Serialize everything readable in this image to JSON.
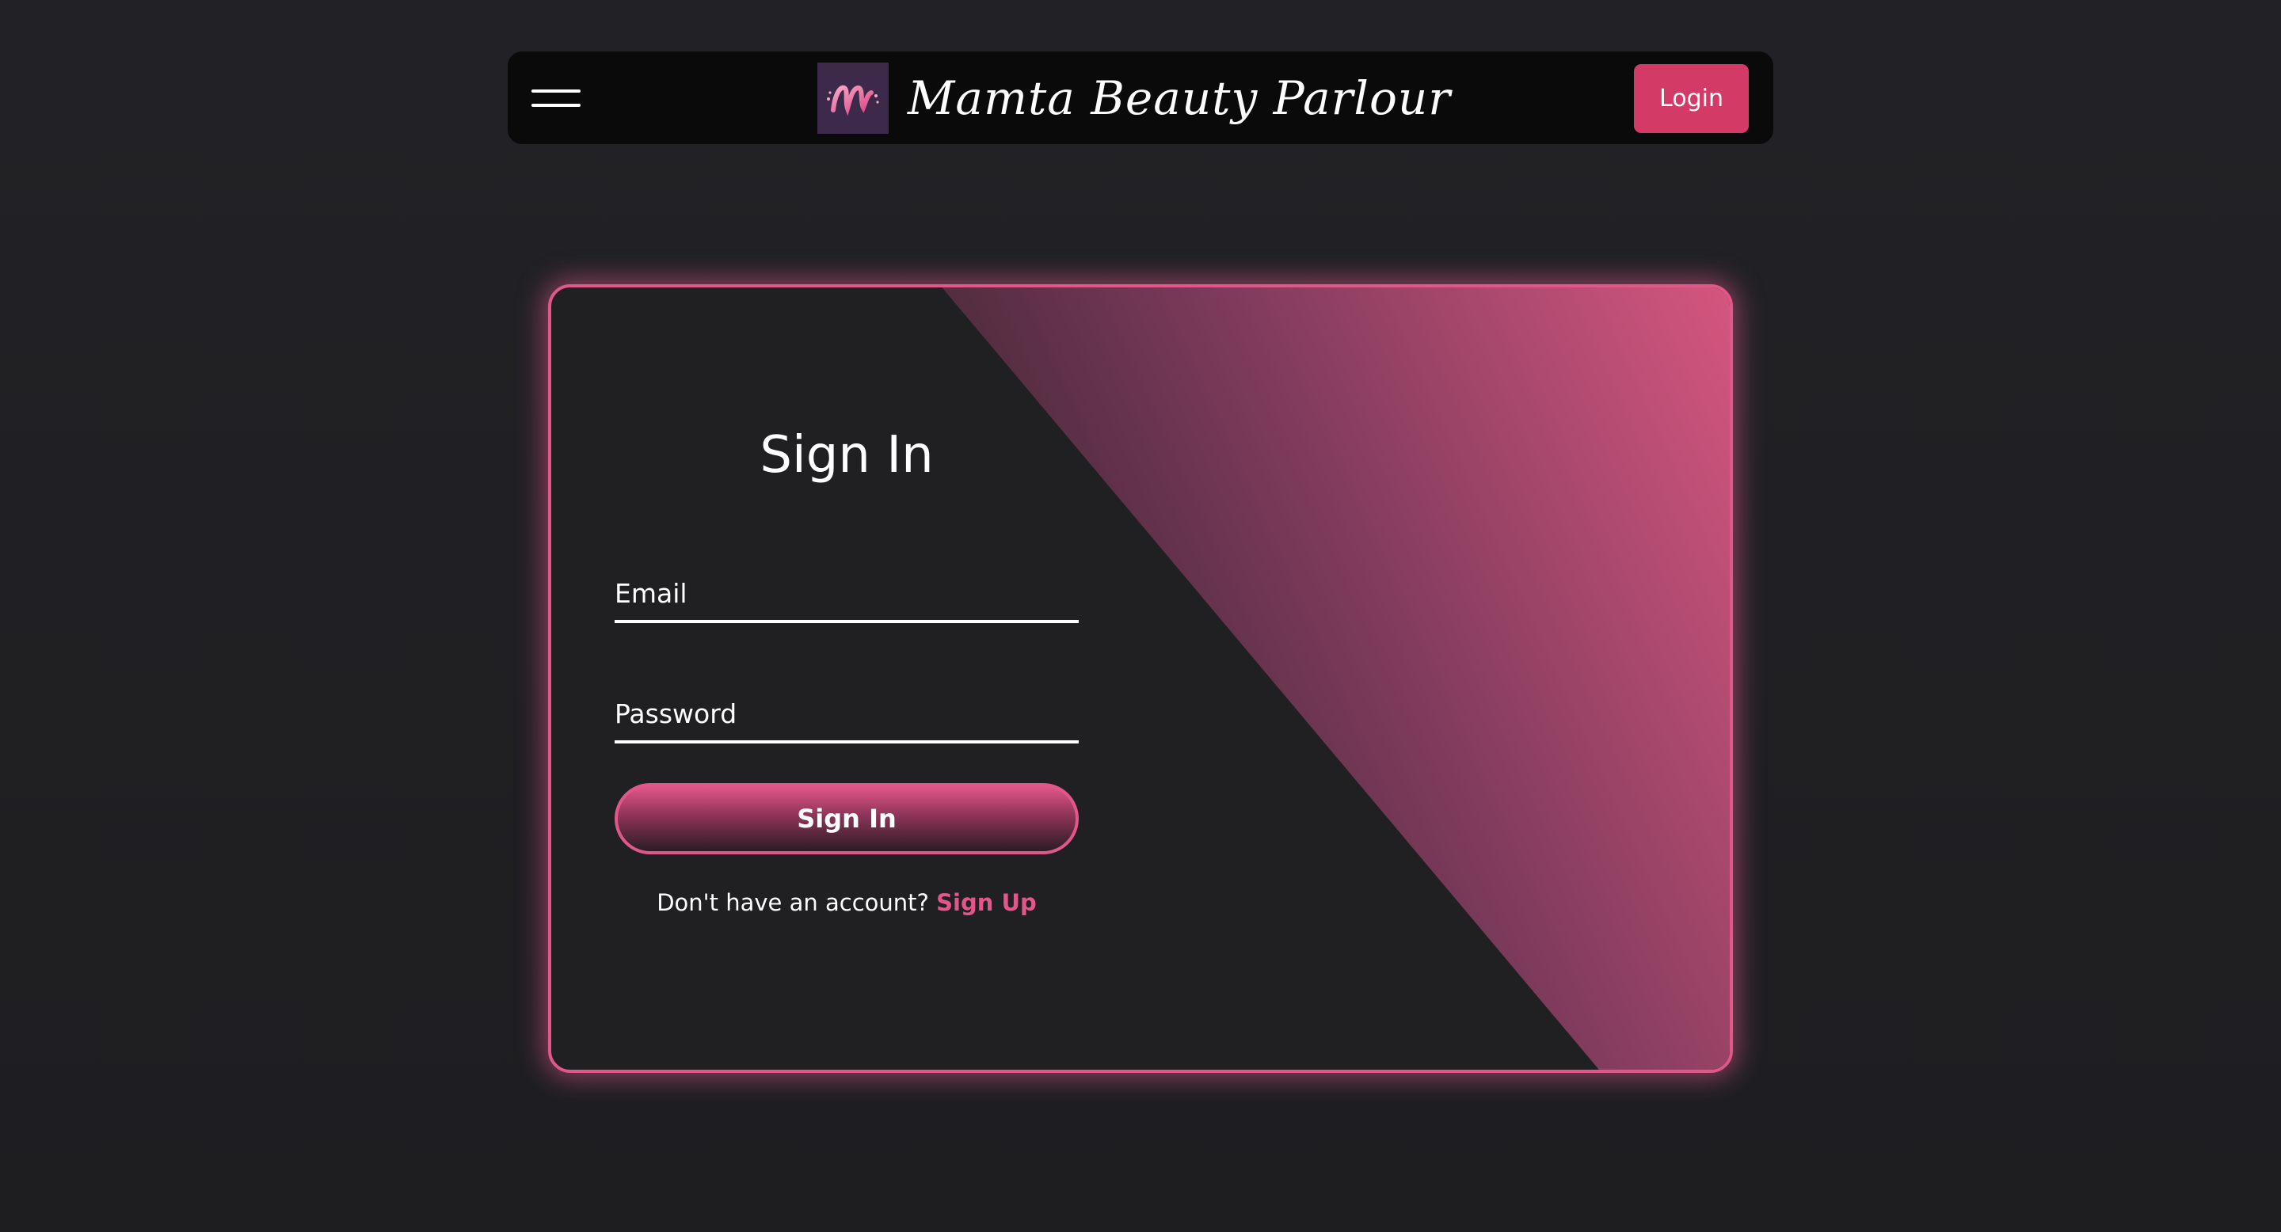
{
  "colors": {
    "accent": "#d33a66",
    "accent_light": "#e2578a",
    "background": "#222226",
    "navbar": "#0a0a0a",
    "logo_bg": "#3d2a4a"
  },
  "navbar": {
    "menu_icon": "hamburger-menu-icon",
    "logo_icon": "m-logo-icon",
    "title": "Mamta Beauty Parlour",
    "login_label": "Login"
  },
  "form": {
    "title": "Sign In",
    "email_placeholder": "Email",
    "email_value": "",
    "password_placeholder": "Password",
    "password_value": "",
    "submit_label": "Sign In",
    "signup_prompt": "Don't have an account?",
    "signup_link": "Sign Up"
  }
}
